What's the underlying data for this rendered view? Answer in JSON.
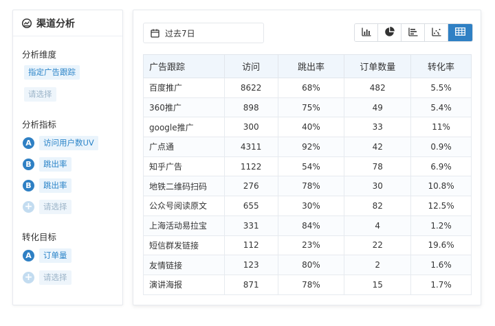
{
  "sidebar": {
    "title": "渠道分析",
    "dimension": {
      "title": "分析维度",
      "selected": "指定广告跟踪",
      "placeholder": "请选择"
    },
    "metrics": {
      "title": "分析指标",
      "items": [
        {
          "badge": "A",
          "label": "访问用户数UV"
        },
        {
          "badge": "B",
          "label": "跳出率"
        },
        {
          "badge": "B",
          "label": "跳出率"
        }
      ],
      "add_badge": "+",
      "placeholder": "请选择"
    },
    "target": {
      "title": "转化目标",
      "items": [
        {
          "badge": "A",
          "label": "订单量"
        }
      ],
      "add_badge": "+",
      "placeholder": "请选择"
    }
  },
  "toolbar": {
    "date_range": "过去7日",
    "chart_types": [
      "bar-chart-icon",
      "pie-chart-icon",
      "horizontal-bar-icon",
      "scatter-chart-icon",
      "table-icon"
    ],
    "active_chart_type": "table-icon"
  },
  "table": {
    "headers": [
      "广告跟踪",
      "访问",
      "跳出率",
      "订单数量",
      "转化率"
    ],
    "rows": [
      [
        "百度推广",
        "8622",
        "68%",
        "482",
        "5.5%"
      ],
      [
        "360推广",
        "898",
        "75%",
        "49",
        "5.4%"
      ],
      [
        "google推广",
        "300",
        "40%",
        "33",
        "11%"
      ],
      [
        "广点通",
        "4311",
        "92%",
        "42",
        "0.9%"
      ],
      [
        "知乎广告",
        "1122",
        "54%",
        "78",
        "6.9%"
      ],
      [
        "地铁二维码扫码",
        "276",
        "78%",
        "30",
        "10.8%"
      ],
      [
        "公众号阅读原文",
        "655",
        "30%",
        "82",
        "12.5%"
      ],
      [
        "上海活动易拉宝",
        "331",
        "84%",
        "4",
        "1.2%"
      ],
      [
        "短信群发链接",
        "112",
        "23%",
        "22",
        "19.6%"
      ],
      [
        "友情链接",
        "123",
        "80%",
        "2",
        "1.6%"
      ],
      [
        "演讲海报",
        "871",
        "78%",
        "15",
        "1.7%"
      ]
    ]
  },
  "colors": {
    "accent": "#2f80c4",
    "chip_bg": "#eaf4fc",
    "header_bg": "#f0f6fc"
  }
}
